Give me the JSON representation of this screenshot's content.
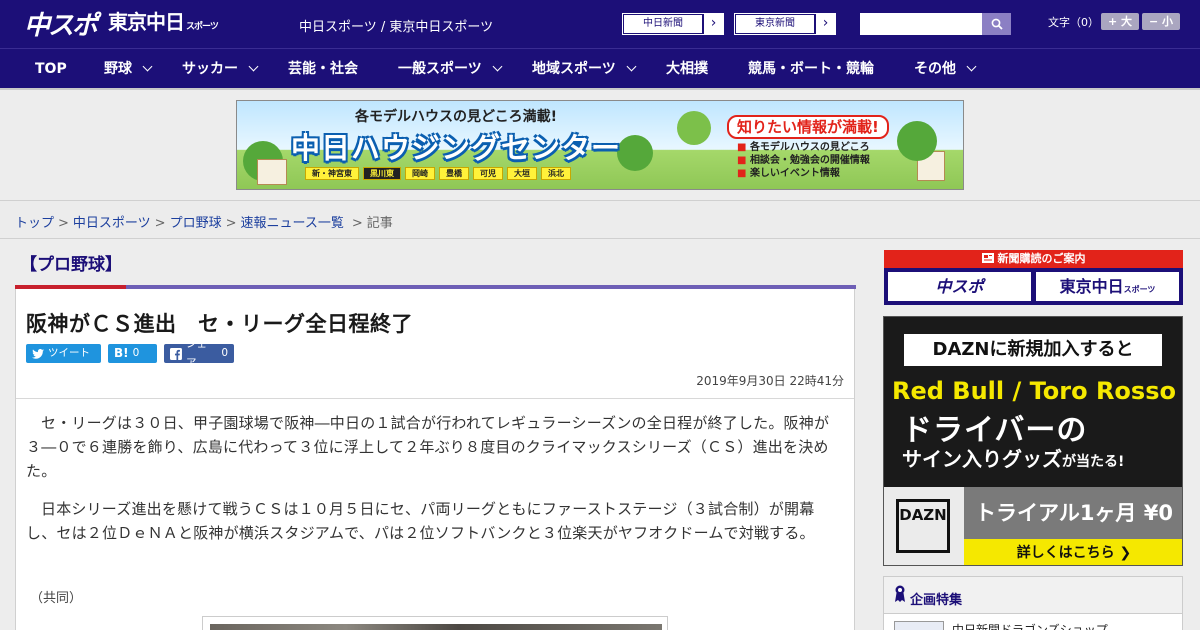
{
  "header": {
    "logo_main": "中スポ",
    "logo_tokyo": "東京中日",
    "logo_tokyo_suffix": "スポーツ",
    "site_links": "中日スポーツ / 東京中日スポーツ",
    "paper_buttons": [
      "中日新聞",
      "東京新聞"
    ],
    "search_placeholder": "",
    "font_size_label": "文字（0）",
    "font_plus": "+ 大",
    "font_minus": "− 小"
  },
  "nav": {
    "items": [
      "TOP",
      "野球",
      "サッカー",
      "芸能・社会",
      "一般スポーツ",
      "地域スポーツ",
      "大相撲",
      "競馬・ボート・競輪",
      "その他"
    ]
  },
  "banner": {
    "subtitle": "各モデルハウスの見どころ満載!",
    "title": "中日ハウジングセンター",
    "locations": [
      "新・神宮東",
      "黒川東",
      "岡崎",
      "豊橋",
      "可児",
      "大垣",
      "浜北"
    ],
    "right_title": "知りたい情報が満載!",
    "right_list": [
      "各モデルハウスの見どころ",
      "相談会・勉強会の開催情報",
      "楽しいイベント情報"
    ]
  },
  "breadcrumb": {
    "items": [
      "トップ",
      "中日スポーツ",
      "プロ野球",
      "速報ニュース一覧"
    ],
    "current": "記事"
  },
  "article": {
    "category": "【プロ野球】",
    "headline": "阪神がＣＳ進出　セ・リーグ全日程終了",
    "share": {
      "tweet": "ツイート",
      "hatena": "B!",
      "hatena_count": "0",
      "facebook": "シェア",
      "facebook_count": "0"
    },
    "date": "2019年9月30日 22時41分",
    "paragraphs": [
      "セ・リーグは３０日、甲子園球場で阪神―中日の１試合が行われてレギュラーシーズンの全日程が終了した。阪神が３―０で６連勝を飾り、広島に代わって３位に浮上して２年ぶり８度目のクライマックスシリーズ（ＣＳ）進出を決めた。",
      "日本シリーズ進出を懸けて戦うＣＳは１０月５日にセ、パ両リーグともにファーストステージ（３試合制）が開幕し、セは２位ＤｅＮＡと阪神が横浜スタジアムで、パは２位ソフトバンクと３位楽天がヤフオクドームで対戦する。"
    ],
    "credit": "（共同）"
  },
  "sidebar": {
    "subscribe": {
      "header": "新聞購読のご案内",
      "left": "中スポ",
      "right": "東京中日",
      "right_suffix": "スポーツ"
    },
    "ad": {
      "title": "DAZNに新規加入すると",
      "brand": "Red Bull / Toro Rosso",
      "driver": "ドライバーの",
      "goods": "サイン入りグッズ",
      "goods_suffix": "が当たる!",
      "logo": "DAZN",
      "trial": "トライアル1ヶ月 ¥0",
      "more": "詳しくはこちら ❯"
    },
    "feature": {
      "title": "企画特集",
      "item": "中日新聞ドラゴンズショップ"
    }
  },
  "colors": {
    "brand": "#1c0f78",
    "accent_red": "#c7202d",
    "twitter": "#1f94de",
    "facebook": "#3b5ca0"
  }
}
